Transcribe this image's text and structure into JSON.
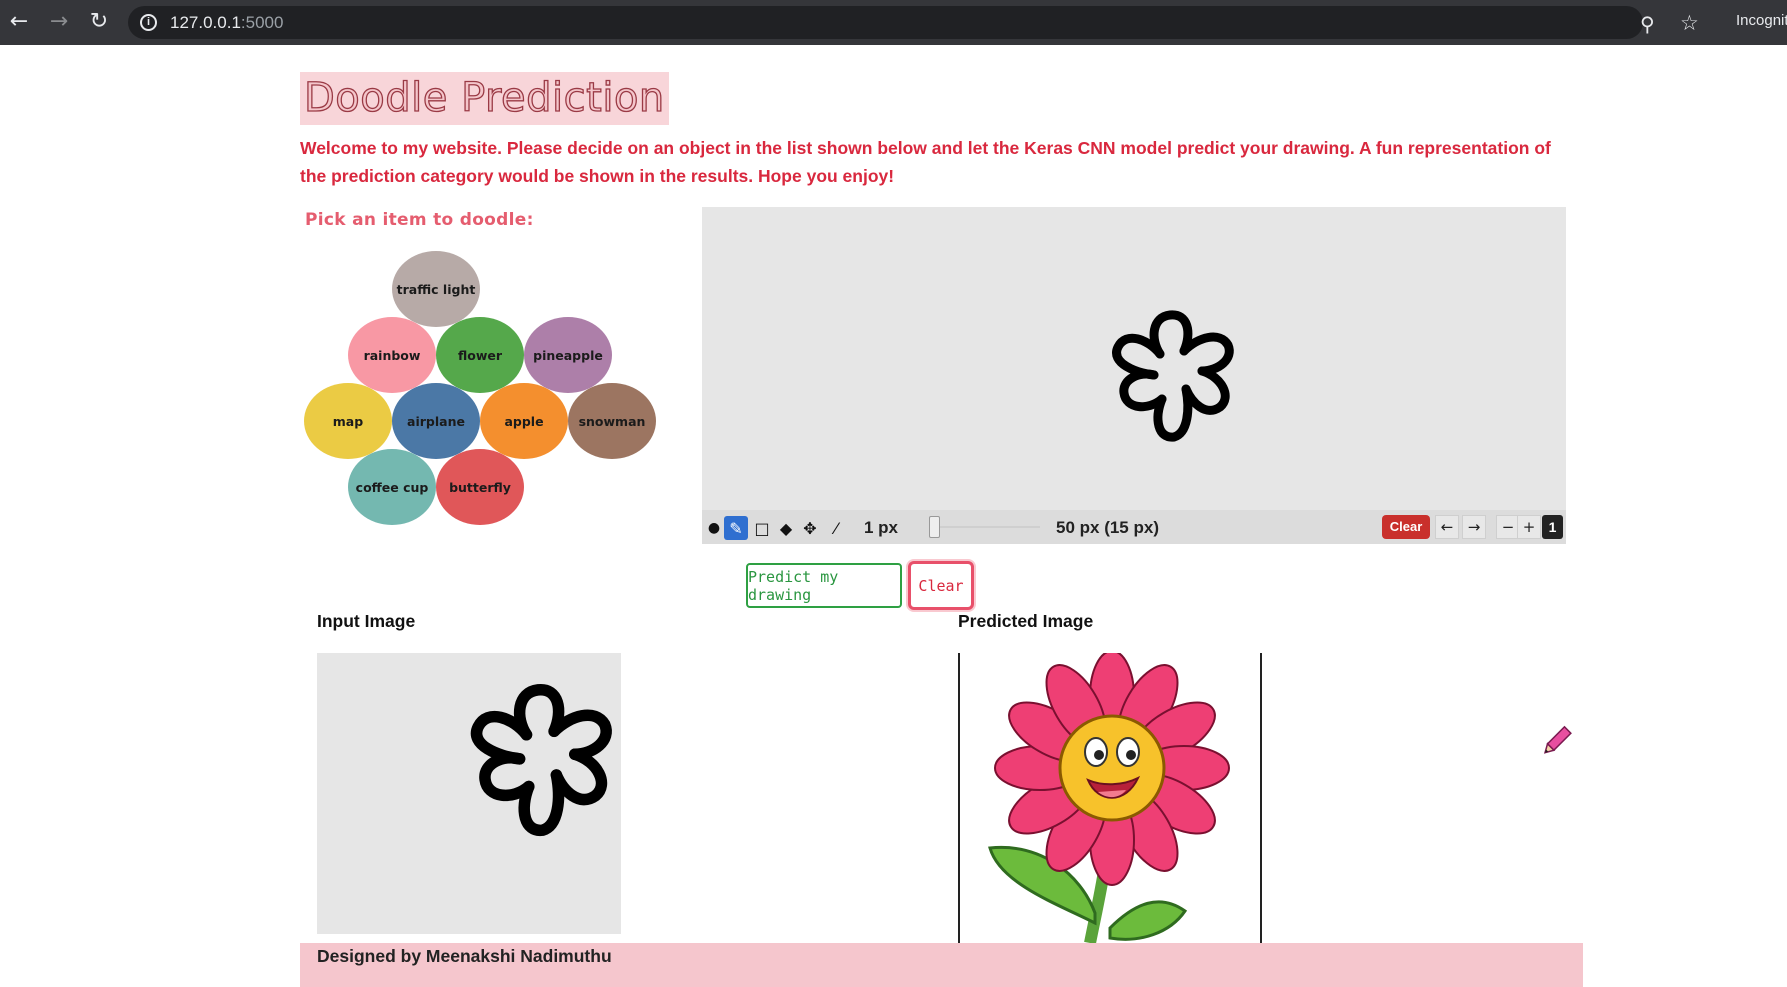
{
  "browser": {
    "url_host": "127.0.0.1",
    "url_port": ":5000",
    "incognito_label": "Incognito"
  },
  "page": {
    "title": "Doodle Prediction",
    "welcome": "Welcome to my website. Please decide on an object in the list shown below and let the Keras CNN model predict your drawing. A fun representation of the prediction category would be shown in the results. Hope you enjoy!",
    "pick_label": "Pick an item to doodle:"
  },
  "items": [
    {
      "label": "traffic light",
      "color": "#b7aaa7"
    },
    {
      "label": "rainbow",
      "color": "#f898a4"
    },
    {
      "label": "flower",
      "color": "#55a84b"
    },
    {
      "label": "pineapple",
      "color": "#ad7fa9"
    },
    {
      "label": "map",
      "color": "#ebcb44"
    },
    {
      "label": "airplane",
      "color": "#4b78a6"
    },
    {
      "label": "apple",
      "color": "#f48f2e"
    },
    {
      "label": "snowman",
      "color": "#9c7561"
    },
    {
      "label": "coffee cup",
      "color": "#74b8b0"
    },
    {
      "label": "butterfly",
      "color": "#e05759"
    }
  ],
  "toolbar": {
    "stroke_width": "1 px",
    "brush_size": "50 px (15 px)",
    "clear_label": "Clear",
    "undo": "←",
    "redo": "→",
    "zoom_out": "−",
    "zoom_in": "+",
    "page": "1"
  },
  "actions": {
    "predict_label": "Predict my drawing",
    "clear_label": "Clear"
  },
  "results": {
    "input_label": "Input Image",
    "predicted_label": "Predicted Image"
  },
  "footer": {
    "text": "Designed by Meenakshi Nadimuthu"
  }
}
